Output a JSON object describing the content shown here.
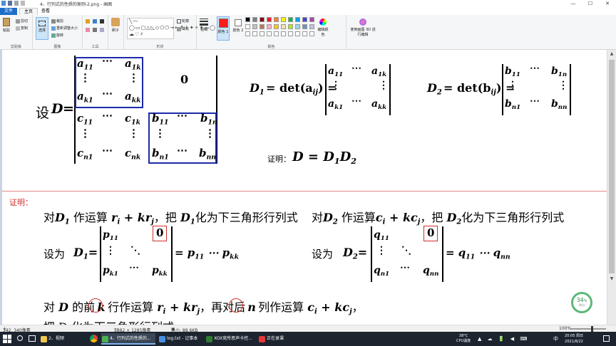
{
  "window": {
    "title": "4、行列式的性质的案例-2.png - 画图",
    "controls": [
      "—",
      "☐",
      "✕"
    ]
  },
  "tabs": {
    "file": "文件",
    "home": "主页",
    "view": "查看"
  },
  "ribbon": {
    "clipboard": {
      "paste": "粘贴",
      "cut": "剪切",
      "copy": "复制",
      "label": "剪贴板"
    },
    "image": {
      "select": "选择",
      "crop": "裁剪",
      "resize": "重新调整大小",
      "rotate": "旋转",
      "label": "图像"
    },
    "tools": {
      "label": "工具"
    },
    "brushes": {
      "label": "刷子"
    },
    "shapes": {
      "outline": "轮廓",
      "fill": "填充",
      "label": "形状"
    },
    "size": {
      "label": "粗细"
    },
    "color1": {
      "label": "颜色 1",
      "value": "#ff1c1c"
    },
    "color2": {
      "label": "颜色 2",
      "value": "#ffffff"
    },
    "colors": {
      "label": "颜色",
      "row1": [
        "#000000",
        "#7f7f7f",
        "#880015",
        "#ed1c24",
        "#ff7f27",
        "#fff200",
        "#22b14c",
        "#00a2e8",
        "#3f48cc",
        "#a349a4"
      ],
      "row2": [
        "#ffffff",
        "#c3c3c3",
        "#b97a57",
        "#ffaec9",
        "#ffc90e",
        "#efe4b0",
        "#b5e61d",
        "#99d9ea",
        "#7092be",
        "#c8bfe7"
      ],
      "row3": [
        "#ffffff",
        "#ffffff",
        "#ffffff",
        "#ffffff",
        "#ffffff",
        "#ffffff",
        "#ffffff",
        "#ffffff",
        "#ffffff",
        "#ffffff"
      ]
    },
    "edit_colors": "编辑颜色",
    "paint3d": "使用画图 3D 进行编辑"
  },
  "canvas": {
    "set_D": "设",
    "D": "D",
    "eq": "=",
    "a11": "a",
    "s11": "11",
    "a1k": "a",
    "s1k": "1k",
    "ak1": "a",
    "sk1": "k1",
    "akk": "a",
    "skk": "kk",
    "c11": "c",
    "c1k": "c",
    "cn1": "c",
    "cnk": "c",
    "cs11": "11",
    "cs1k": "1k",
    "csn1": "n1",
    "csnk": "nk",
    "b11": "b",
    "b1n": "b",
    "bn1": "b",
    "bnn": "b",
    "bs11": "11",
    "bs1n": "1n",
    "bsn1": "n1",
    "bsnn": "nn",
    "zero": "0",
    "cdots": "⋯",
    "vdots": "⋮",
    "ddots": "⋱",
    "D1_def": "D",
    "D1_sub": "1",
    "det_aij": "= det(a",
    "ij": "ij",
    "det_bij": "= det(b",
    "close_eq": ") =",
    "D2_sub": "2",
    "proof_label": "证明：",
    "claim": "D = D",
    "claim_s1": "1",
    "claim_D2": "D",
    "claim_s2": "2",
    "proof_heading": "证明：",
    "line1_left_a": "对",
    "line1_left_b": "作运算",
    "line1_op1": "r",
    "line1_i": "i",
    "line1_plus": " + kr",
    "line1_j": "j",
    "line1_left_c": "，把",
    "line1_left_d": "化为下三角形行列式",
    "line1_right_b": "作运算",
    "line1_op2": "c",
    "line1_plus2": " + kc",
    "set_label": "设为",
    "p11": "p",
    "p11s": "11",
    "pk1": "p",
    "pk1s": "k1",
    "pkk": "p",
    "pkks": "kk",
    "product_p": "= p",
    "prod_ps1": "11",
    "prod_pdots": " ⋯ p",
    "prod_ps2": "kk",
    "q11": "q",
    "q11s": "11",
    "qn1": "q",
    "qn1s": "n1",
    "qnn": "q",
    "qnns": "nn",
    "product_q": "= q",
    "prod_qs1": "11",
    "prod_qdots": " ⋯ q",
    "prod_qs2": "nn",
    "line3_a": "对",
    "line3_b": "的前",
    "line3_k": "k",
    "line3_c": "行作运算",
    "line3_op": "r",
    "line3_plus": " + kr",
    "line3_d": "，再对后",
    "line3_n": "n",
    "line3_e": "列作运算",
    "line3_op2": "c",
    "line3_plus2": " + kc",
    "line3_end": "，",
    "line4": "把 D 化为下三角形行列式"
  },
  "status": {
    "cursor": "342, 340像素",
    "size": "1882 × 1285像素",
    "filesize": "大小: 88.6KB",
    "zoom": "100%"
  },
  "progress": {
    "value": "34",
    "unit": "%",
    "sub": "0K/s"
  },
  "taskbar": {
    "items": [
      {
        "label": "2、视频",
        "color": "#f2c94c"
      },
      {
        "label": "4、行列式的性质的...",
        "color": "#4caf50"
      },
      {
        "label": "log.txt - 记事本",
        "color": "#4a90e2"
      },
      {
        "label": "XOX竞所思声卡控...",
        "color": "#2e7d32"
      },
      {
        "label": "正在录课",
        "color": "#e53935"
      }
    ],
    "temp": "38°C",
    "cpu": "CPU温度",
    "ime": "中",
    "time": "20:05 周日",
    "date": "2021/8/22"
  }
}
